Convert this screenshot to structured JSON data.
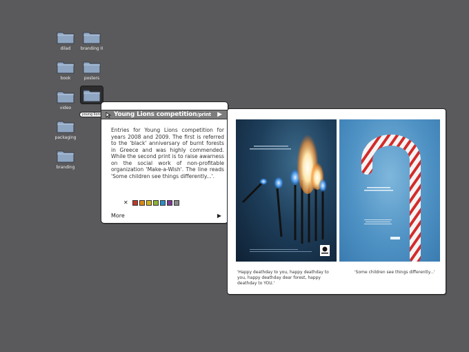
{
  "desktop": {
    "folders": [
      {
        "label": "dilad"
      },
      {
        "label": "branding II"
      },
      {
        "label": "book"
      },
      {
        "label": "posters"
      },
      {
        "label": "video"
      },
      {
        "label": "young lions"
      },
      {
        "label": "packaging"
      },
      {
        "label": "branding"
      }
    ],
    "selected_folder": "young lions"
  },
  "info_panel": {
    "title": "Young Lions competition",
    "title_suffix": "/print",
    "back_icon": "arrow-cursor-icon",
    "next_icon": "play-triangle-icon",
    "description": "Entries for Young Lions competition for years 2008 and 2009. The first is referred to the 'black' anniversary of burnt forests in Greece and was highly commended. While the second print is to raise awarness on the social work of non-profitable organization 'Make-a-Wish'. The line reads 'Some children see things differently...'.",
    "close_icon": "close-x-icon",
    "swatch_colors": [
      "#c0392b",
      "#d58a1a",
      "#d4b31b",
      "#8fb13a",
      "#2a8fc7",
      "#7d3b8f",
      "#888888"
    ],
    "more_label": "More",
    "more_icon": "play-triangle-icon"
  },
  "preview": {
    "poster1": {
      "description_icon": "burning-matches-image"
    },
    "poster2": {
      "description_icon": "candy-cane-image"
    },
    "caption1": "'Happy deathday to you, happy deathday to you, happy deathday dear forest, happy deathday to YOU.'",
    "caption2": "'Some children see things differently...'"
  }
}
